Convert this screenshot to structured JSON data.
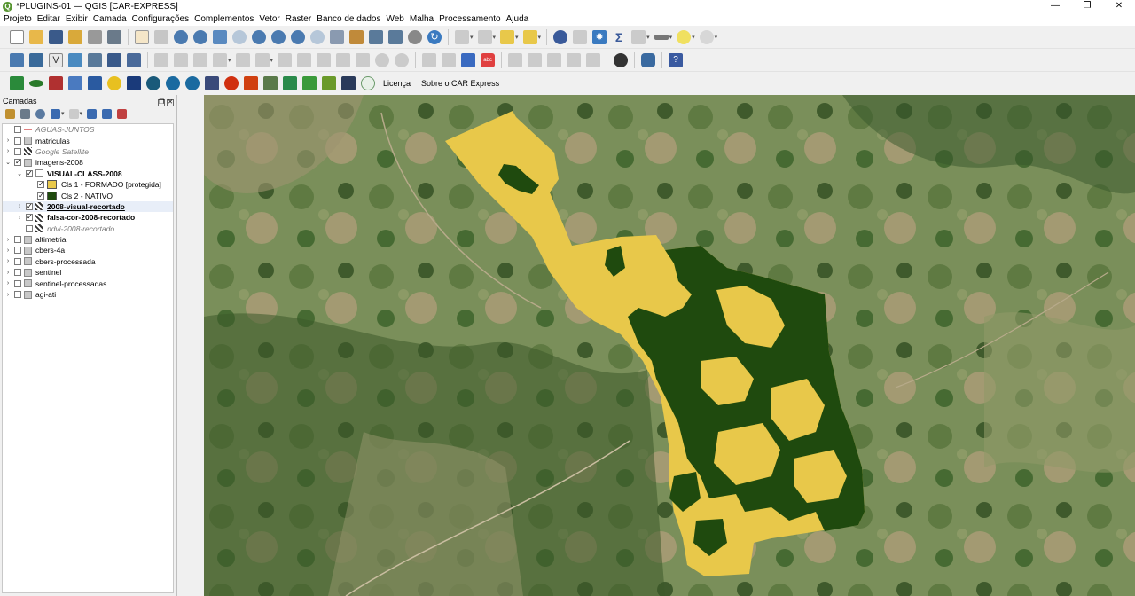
{
  "window": {
    "title": "*PLUGINS-01 — QGIS [CAR-EXPRESS]",
    "controls": [
      "—",
      "❐",
      "✕"
    ]
  },
  "menu": [
    "Projeto",
    "Editar",
    "Exibir",
    "Camada",
    "Configurações",
    "Complementos",
    "Vetor",
    "Raster",
    "Banco de dados",
    "Web",
    "Malha",
    "Processamento",
    "Ajuda"
  ],
  "toolbar3": {
    "licenca": "Licença",
    "sobre": "Sobre o CAR Express"
  },
  "layers_panel": {
    "title": "Camadas",
    "layers": [
      {
        "label": "AGUAS-JUNTOS",
        "checked": false,
        "style": "italic",
        "arrow": "",
        "indent": 0,
        "icon": "line"
      },
      {
        "label": "matriculas",
        "checked": false,
        "style": "normal",
        "arrow": "›",
        "indent": 0,
        "icon": "group"
      },
      {
        "label": "Google Satellite",
        "checked": false,
        "style": "italic",
        "arrow": "›",
        "indent": 0,
        "icon": "raster"
      },
      {
        "label": "imagens-2008",
        "checked": true,
        "style": "normal",
        "arrow": "⌄",
        "indent": 0,
        "icon": "group"
      },
      {
        "label": "VISUAL-CLASS-2008",
        "checked": true,
        "style": "bold",
        "arrow": "⌄",
        "indent": 1,
        "icon": "polygon"
      },
      {
        "label": "Cls 1 - FORMADO [protegida]",
        "checked": true,
        "style": "normal",
        "arrow": "",
        "indent": 2,
        "icon": "swatch",
        "color": "#e8c84a"
      },
      {
        "label": "Cls 2 - NATIVO",
        "checked": true,
        "style": "normal",
        "arrow": "",
        "indent": 2,
        "icon": "swatch",
        "color": "#1f4a0e"
      },
      {
        "label": "2008-visual-recortado",
        "checked": true,
        "style": "bu",
        "arrow": "›",
        "indent": 1,
        "icon": "raster",
        "selected": true
      },
      {
        "label": "falsa-cor-2008-recortado",
        "checked": true,
        "style": "bold",
        "arrow": "›",
        "indent": 1,
        "icon": "raster"
      },
      {
        "label": "ndvi-2008-recortado",
        "checked": false,
        "style": "italic",
        "arrow": "",
        "indent": 1,
        "icon": "raster"
      },
      {
        "label": "altimetria",
        "checked": false,
        "style": "normal",
        "arrow": "›",
        "indent": 0,
        "icon": "group"
      },
      {
        "label": "cbers-4a",
        "checked": false,
        "style": "normal",
        "arrow": "›",
        "indent": 0,
        "icon": "group"
      },
      {
        "label": "cbers-processada",
        "checked": false,
        "style": "normal",
        "arrow": "›",
        "indent": 0,
        "icon": "group"
      },
      {
        "label": "sentinel",
        "checked": false,
        "style": "normal",
        "arrow": "›",
        "indent": 0,
        "icon": "group"
      },
      {
        "label": "sentinel-processadas",
        "checked": false,
        "style": "normal",
        "arrow": "›",
        "indent": 0,
        "icon": "group"
      },
      {
        "label": "agi-ati",
        "checked": false,
        "style": "normal",
        "arrow": "›",
        "indent": 0,
        "icon": "group"
      }
    ]
  },
  "colors": {
    "formado": "#e8c84a",
    "nativo": "#1f4a0e",
    "map_bg": "#6b8650",
    "qgis_green": "#589632"
  }
}
